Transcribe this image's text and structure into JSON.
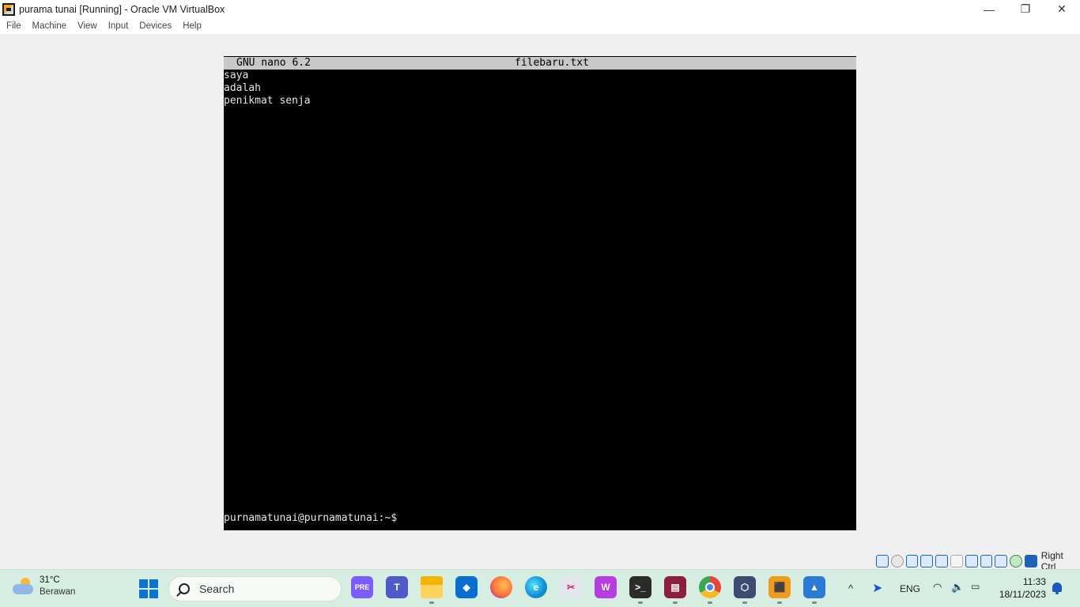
{
  "window": {
    "title": "purama tunai [Running] - Oracle VM VirtualBox",
    "minimize_glyph": "—",
    "restore_glyph": "❐",
    "close_glyph": "✕"
  },
  "menu": [
    "File",
    "Machine",
    "View",
    "Input",
    "Devices",
    "Help"
  ],
  "terminal": {
    "nano_version": "GNU nano 6.2",
    "file_name": "filebaru.txt",
    "lines": [
      "saya",
      "adalah",
      "penikmat senja"
    ],
    "prompt": "purnamatunai@purnamatunai:~$"
  },
  "vbox_status": {
    "icons": [
      "hard-disk-icon",
      "optical-drive-icon",
      "audio-icon",
      "network-icon",
      "usb-icon",
      "shared-folders-icon",
      "display-icon",
      "recording-icon",
      "cpu-icon",
      "mouse-integration-icon",
      "keyboard-icon"
    ],
    "host_key": "Right Ctrl"
  },
  "taskbar": {
    "weather": {
      "temp": "31°C",
      "desc": "Berawan"
    },
    "search_label": "Search",
    "apps": [
      {
        "name": "copilot-icon",
        "color": "#7a5cff",
        "glyph": "PRE"
      },
      {
        "name": "teams-icon",
        "color": "#5059c9",
        "glyph": "T"
      },
      {
        "name": "file-explorer-icon",
        "color": "#f4b400",
        "glyph": ""
      },
      {
        "name": "defender-icon",
        "color": "#0a6ed1",
        "glyph": "◈"
      },
      {
        "name": "firefox-icon",
        "color": "#ff7139",
        "glyph": ""
      },
      {
        "name": "edge-icon",
        "color": "#0e8bd6",
        "glyph": "e"
      },
      {
        "name": "snipping-tool-icon",
        "color": "#e2e7ee",
        "glyph": "✂"
      },
      {
        "name": "wps-office-icon",
        "color": "#b73de0",
        "glyph": "W"
      },
      {
        "name": "terminal-icon",
        "color": "#2b2b2b",
        "glyph": ">_"
      },
      {
        "name": "winrar-icon",
        "color": "#8d1f3d",
        "glyph": "▤"
      },
      {
        "name": "chrome-icon",
        "color": "#e8453c",
        "glyph": ""
      },
      {
        "name": "virtualbox-icon",
        "color": "#3d4b73",
        "glyph": "⬡"
      },
      {
        "name": "virtualbox-vm-icon",
        "color": "#f29a1c",
        "glyph": "⬛"
      },
      {
        "name": "photos-icon",
        "color": "#2a7ad6",
        "glyph": "▲"
      }
    ],
    "tray": {
      "chevron": "^",
      "language": "ENG",
      "time": "11:33",
      "date": "18/11/2023"
    }
  }
}
